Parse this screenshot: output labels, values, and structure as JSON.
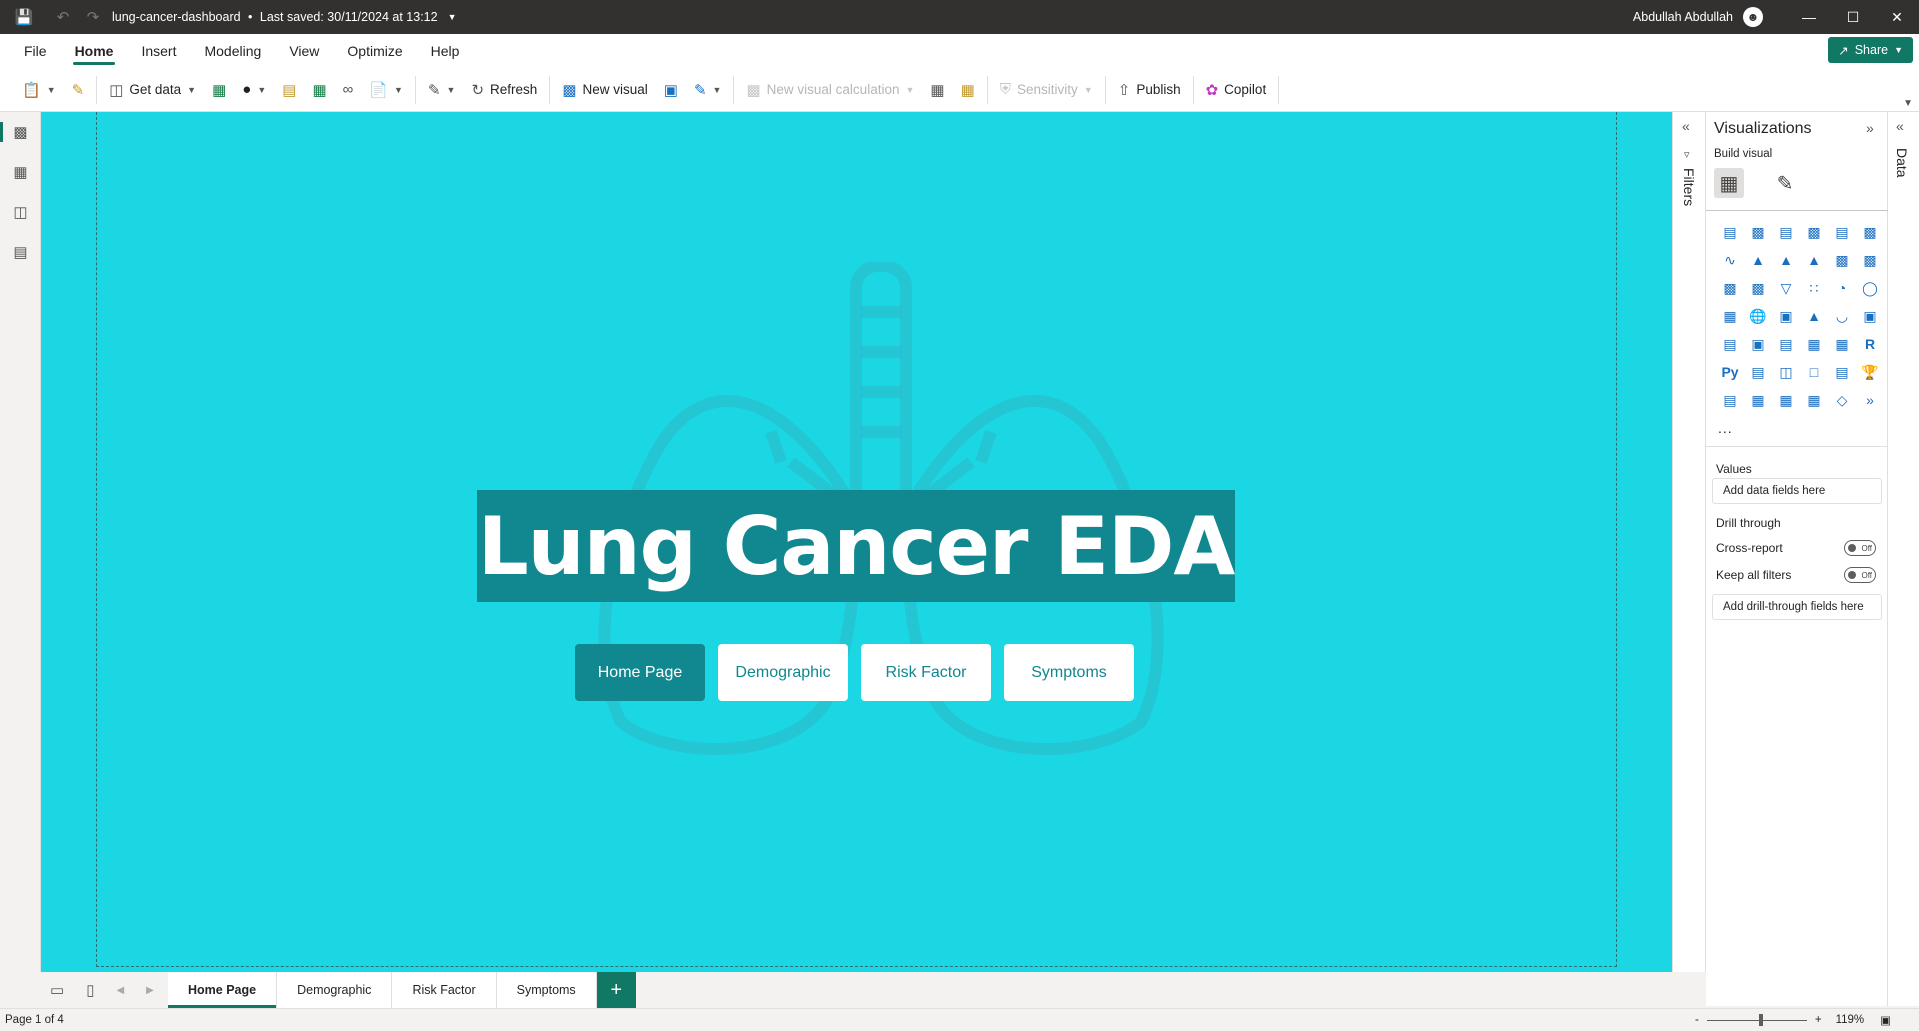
{
  "titlebar": {
    "document": "lung-cancer-dashboard",
    "saved": "Last saved: 30/11/2024 at 13:12",
    "user": "Abdullah Abdullah"
  },
  "menu": {
    "items": [
      "File",
      "Home",
      "Insert",
      "Modeling",
      "View",
      "Optimize",
      "Help"
    ],
    "active": "Home",
    "share_label": "Share"
  },
  "toolbar": {
    "get_data": "Get data",
    "refresh": "Refresh",
    "new_visual": "New visual",
    "new_visual_calculation": "New visual calculation",
    "sensitivity": "Sensitivity",
    "publish": "Publish",
    "copilot": "Copilot"
  },
  "canvas": {
    "title": "Lung Cancer EDA",
    "background_color": "#1bd7e4",
    "accent_color": "#11878f",
    "nav_buttons": [
      "Home Page",
      "Demographic",
      "Risk Factor",
      "Symptoms"
    ],
    "active_nav": "Home Page"
  },
  "filters_pane": {
    "label": "Filters"
  },
  "visualizations": {
    "title": "Visualizations",
    "build_visual": "Build visual",
    "more": "...",
    "values_label": "Values",
    "values_placeholder": "Add data fields here",
    "drill_through_label": "Drill through",
    "cross_report_label": "Cross-report",
    "cross_report_state": "Off",
    "keep_all_filters_label": "Keep all filters",
    "keep_all_filters_state": "Off",
    "drill_placeholder": "Add drill-through fields here"
  },
  "data_pane": {
    "label": "Data"
  },
  "page_tabs": [
    "Home Page",
    "Demographic",
    "Risk Factor",
    "Symptoms"
  ],
  "active_tab": "Home Page",
  "statusbar": {
    "page_info": "Page 1 of 4",
    "zoom": "119%"
  }
}
